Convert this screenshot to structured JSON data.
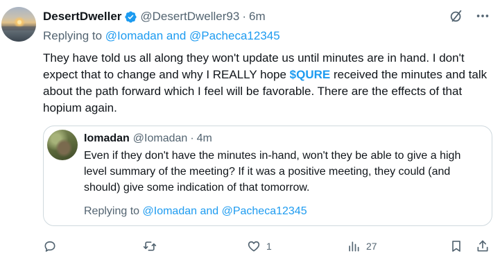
{
  "tweet": {
    "author": {
      "name": "DesertDweller",
      "handle": "@DesertDweller93",
      "separator": "·",
      "time": "6m",
      "verified": true
    },
    "replying": {
      "prefix": "Replying to ",
      "targets": "@Iomadan and @Pacheca12345"
    },
    "text": {
      "before": "They have told us all along they won't update us until minutes are in hand. I don't expect that to change and why I REALLY hope ",
      "cashtag": "$QURE",
      "after": " received the minutes and talk about the path forward which I feel will be favorable. There are the effects of that hopium again."
    }
  },
  "quote": {
    "author": {
      "name": "Iomadan",
      "handle": "@Iomadan",
      "separator": "·",
      "time": "4m"
    },
    "text": "Even if they don't have the minutes in-hand, won't they be able to give a high level summary of the meeting? If it was a positive meeting, they could (and should) give some indication of that tomorrow.",
    "replying": {
      "prefix": "Replying to ",
      "targets": "@Iomadan and @Pacheca12345"
    }
  },
  "actions": {
    "reply_count": "",
    "retweet_count": "",
    "like_count": "1",
    "views_count": "27"
  },
  "icons": {
    "verified": "verified-badge-icon",
    "grok": "grok-icon",
    "more": "more-icon",
    "reply": "reply-icon",
    "retweet": "retweet-icon",
    "like": "heart-icon",
    "views": "views-icon",
    "bookmark": "bookmark-icon",
    "share": "share-icon"
  },
  "colors": {
    "link": "#1d9bf0",
    "secondary": "#536471",
    "text": "#0f1419",
    "border": "#cfd9de"
  }
}
